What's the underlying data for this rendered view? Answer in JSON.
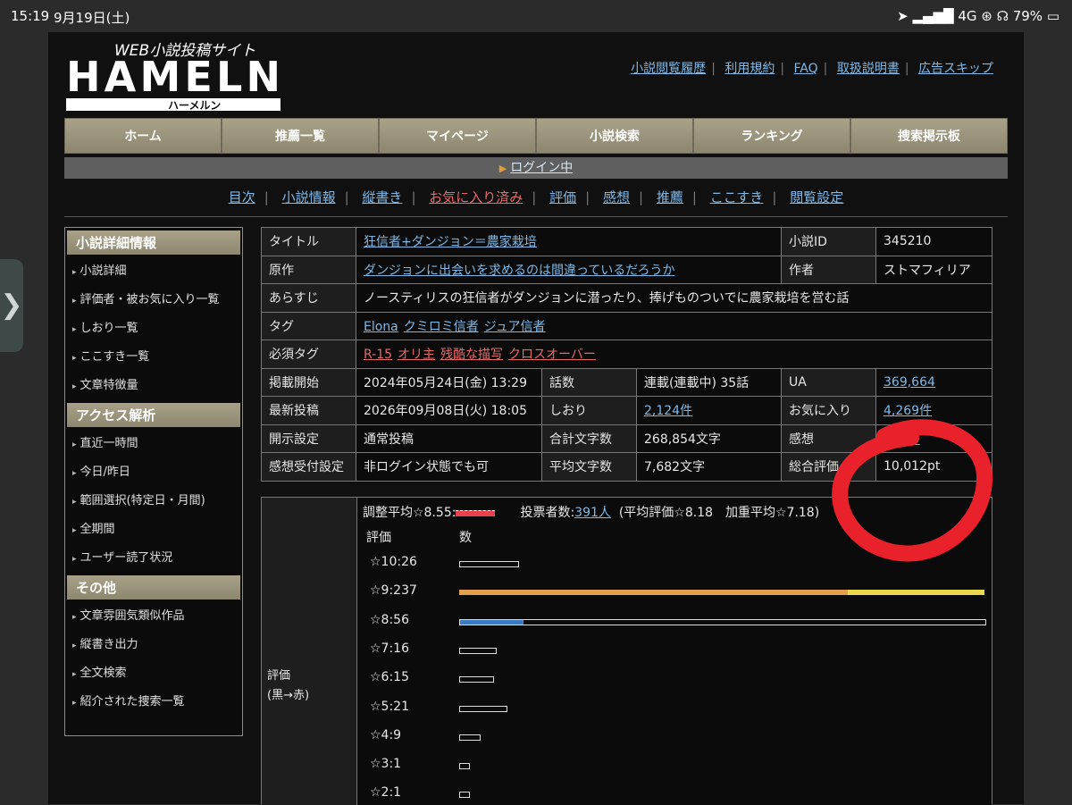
{
  "status": {
    "time": "15:19",
    "date": "9月19日(土)",
    "right": "➤ ▂▄▆█ 4G ⊛ ☊ 79% ▭"
  },
  "site": {
    "logo_top": "WEB小説投稿サイト",
    "logo_main": "HAMELN",
    "logo_sub": "ハーメルン"
  },
  "toplinks": [
    "小説閲覧履歴",
    "利用規約",
    "FAQ",
    "取扱説明書",
    "広告スキップ"
  ],
  "gnav": [
    "ホーム",
    "推薦一覧",
    "マイページ",
    "小説検索",
    "ランキング",
    "捜索掲示板"
  ],
  "login": "ログイン中",
  "subnav": [
    "目次",
    "小説情報",
    "縦書き",
    "お気に入り済み",
    "評価",
    "感想",
    "推薦",
    "ここすき",
    "閲覧設定"
  ],
  "sidebar": [
    {
      "head": "小説詳細情報",
      "items": [
        "小説詳細",
        "評価者・被お気に入り一覧",
        "しおり一覧",
        "ここすき一覧",
        "文章特徴量"
      ]
    },
    {
      "head": "アクセス解析",
      "items": [
        "直近一時間",
        "今日/昨日",
        "範囲選択(特定日・月間)",
        "全期間",
        "ユーザー読了状況"
      ]
    },
    {
      "head": "その他",
      "items": [
        "文章雰囲気類似作品",
        "縦書き出力",
        "全文検索",
        "紹介された捜索一覧"
      ]
    }
  ],
  "info": {
    "title_h": "タイトル",
    "title": "狂信者+ダンジョン＝農家栽培",
    "id_h": "小説ID",
    "id": "345210",
    "orig_h": "原作",
    "orig": "ダンジョンに出会いを求めるのは間違っているだろうか",
    "author_h": "作者",
    "author": "ストマフィリア",
    "synopsis_h": "あらすじ",
    "synopsis": "ノースティリスの狂信者がダンジョンに潜ったり、捧げものついでに農家栽培を営む話",
    "tags_h": "タグ",
    "tags": [
      "Elona",
      "クミロミ信者",
      "ジュア信者"
    ],
    "req_h": "必須タグ",
    "req": [
      "R-15",
      "オリ主",
      "残酷な描写",
      "クロスオーバー"
    ],
    "start_h": "掲載開始",
    "start": "2024年05月24日(金) 13:29",
    "eps_h": "話数",
    "eps": "連載(連載中) 35話",
    "ua_h": "UA",
    "ua": "369,664",
    "latest_h": "最新投稿",
    "latest": "2026年09月08日(火) 18:05",
    "bm_h": "しおり",
    "bm": "2,124件",
    "fav_h": "お気に入り",
    "fav": "4,269件",
    "open_h": "開示設定",
    "open": "通常投稿",
    "chars_h": "合計文字数",
    "chars": "268,854文字",
    "imp_h": "感想",
    "imp": "201件",
    "recv_h": "感想受付設定",
    "recv": "非ログイン状態でも可",
    "avg_h": "平均文字数",
    "avg": "7,682文字",
    "total_h": "総合評価",
    "total": "10,012pt"
  },
  "eval": {
    "head": "評価",
    "head2": "(黒→赤)",
    "adj": "調整平均☆8.55:",
    "voters_label": "投票者数:",
    "voters": "391人",
    "avg": "(平均評価☆8.18　加重平均☆7.18)",
    "col1": "評価",
    "col2": "数",
    "rows": [
      {
        "label": "☆10:26",
        "count": 26
      },
      {
        "label": "☆9:237",
        "count": 237
      },
      {
        "label": "☆8:56",
        "count": 56
      },
      {
        "label": "☆7:16",
        "count": 16
      },
      {
        "label": "☆6:15",
        "count": 15
      },
      {
        "label": "☆5:21",
        "count": 21
      },
      {
        "label": "☆4:9",
        "count": 9
      },
      {
        "label": "☆3:1",
        "count": 1
      },
      {
        "label": "☆2:1",
        "count": 1
      }
    ]
  },
  "colors": {
    "annotation": "#e8212b",
    "bar9_left": "#e3a04a",
    "bar9_right": "#e8d84a",
    "bar8_fill": "#3b7bc4"
  }
}
